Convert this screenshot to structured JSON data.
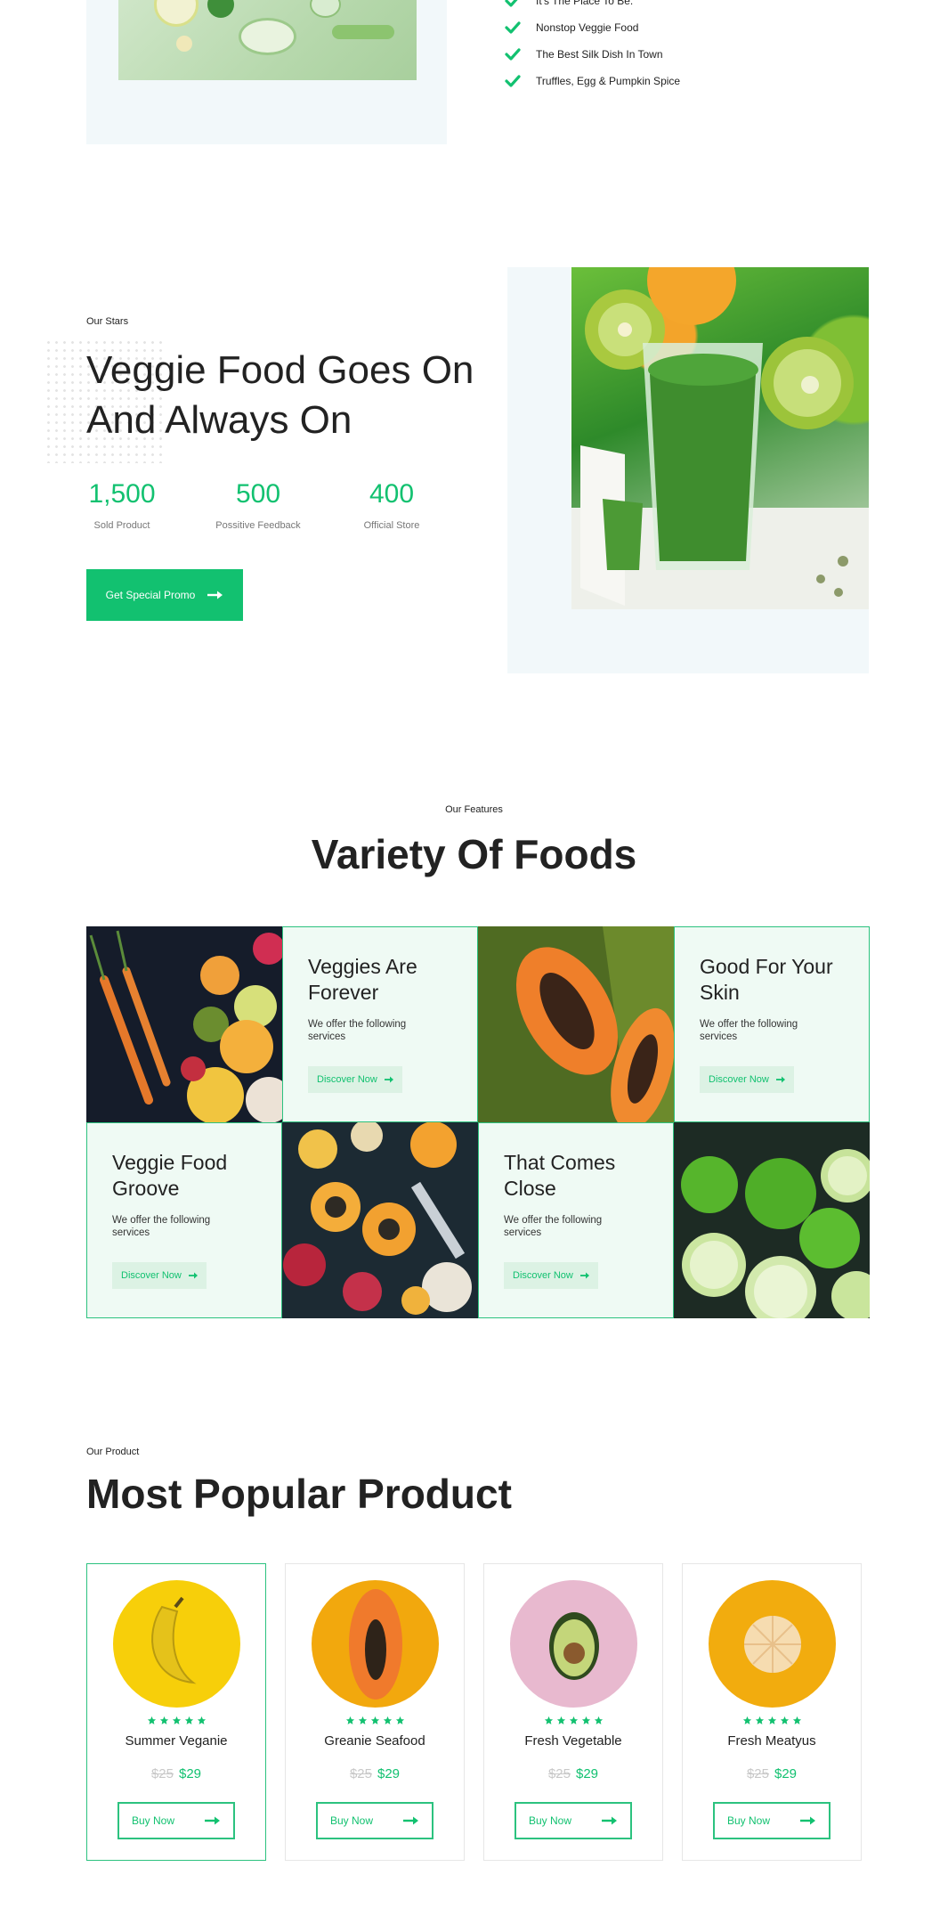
{
  "top": {
    "checklist": [
      "It's The Place To Be.",
      "Nonstop Veggie Food",
      "The Best Silk Dish In Town",
      "Truffles, Egg & Pumpkin Spice"
    ]
  },
  "stars": {
    "subtitle": "Our Stars",
    "heading": "Veggie Food Goes On And Always On",
    "stats": [
      {
        "value": "1,500",
        "label": "Sold Product"
      },
      {
        "value": "500",
        "label": "Possitive Feedback"
      },
      {
        "value": "400",
        "label": "Official Store"
      }
    ],
    "cta_label": "Get Special Promo"
  },
  "features": {
    "subtitle": "Our Features",
    "heading": "Variety Of Foods",
    "cards": [
      {
        "title": "Veggies Are Forever",
        "text": "We offer the following services",
        "button": "Discover Now"
      },
      {
        "title": "Good For Your Skin",
        "text": "We offer the following services",
        "button": "Discover Now"
      },
      {
        "title": "Veggie Food Groove",
        "text": "We offer the following services",
        "button": "Discover Now"
      },
      {
        "title": "That Comes Close",
        "text": "We offer the following services",
        "button": "Discover Now"
      }
    ]
  },
  "products": {
    "subtitle": "Our Product",
    "heading": "Most Popular Product",
    "items": [
      {
        "name": "Summer Veganie",
        "old_price": "$25",
        "price": "$29",
        "button": "Buy Now",
        "rating": 5,
        "circle_color": "#f7cf0a"
      },
      {
        "name": "Greanie Seafood",
        "old_price": "$25",
        "price": "$29",
        "button": "Buy Now",
        "rating": 5,
        "circle_color": "#f2a80d"
      },
      {
        "name": "Fresh Vegetable",
        "old_price": "$25",
        "price": "$29",
        "button": "Buy Now",
        "rating": 5,
        "circle_color": "#e8b9cf"
      },
      {
        "name": "Fresh Meatyus",
        "old_price": "$25",
        "price": "$29",
        "button": "Buy Now",
        "rating": 5,
        "circle_color": "#f2ac0e"
      }
    ]
  },
  "colors": {
    "accent": "#12c170",
    "card_bg": "#effaf4",
    "soft_bg": "#f2f8fa"
  }
}
